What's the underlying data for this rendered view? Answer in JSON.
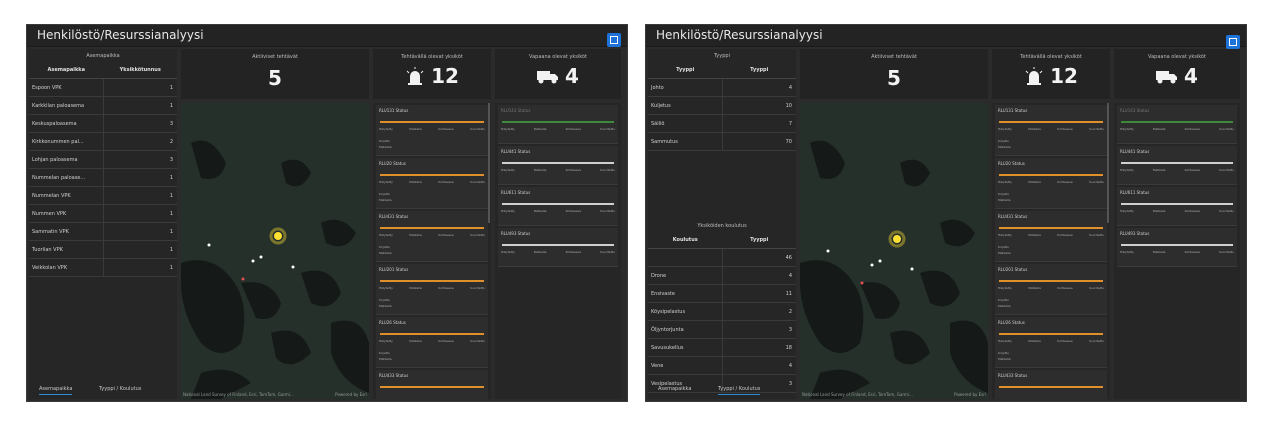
{
  "app_title": "Henkilöstö/Resurssianalyysi",
  "colors": {
    "accent": "#1e73d9",
    "orange": "#e0902a",
    "bg": "#2b2b2b",
    "marker": "#ffe033"
  },
  "icons": {
    "expand": "expand-icon",
    "siren": "siren-icon",
    "truck": "truck-icon"
  },
  "kpis": {
    "active_title": "Aktiiviset tehtävät",
    "active_value": "5",
    "onmission_title": "Tehtävällä olevat yksiköt",
    "onmission_value": "12",
    "free_title": "Vapaana olevat yksiköt",
    "free_value": "4"
  },
  "left": {
    "panel_title": "Asemapaikka",
    "headers": [
      "Asemapaikka",
      "Yksikkötunnus"
    ],
    "rows": [
      {
        "name": "Espoon VPK",
        "value": "1"
      },
      {
        "name": "Karkkilan paloasema",
        "value": "1"
      },
      {
        "name": "Keskuspaloasema",
        "value": "3"
      },
      {
        "name": "Kirkkonummen pal...",
        "value": "2"
      },
      {
        "name": "Lohjan paloasema",
        "value": "3"
      },
      {
        "name": "Nummelan paloase...",
        "value": "1"
      },
      {
        "name": "Nummelan VPK",
        "value": "1"
      },
      {
        "name": "Nummen VPK",
        "value": "1"
      },
      {
        "name": "Sammatin VPK",
        "value": "1"
      },
      {
        "name": "Tuorilan VPK",
        "value": "1"
      },
      {
        "name": "Veikkolan VPK",
        "value": "1"
      }
    ],
    "tabs": [
      "Asemapaikka",
      "Tyyppi / Koulutus"
    ]
  },
  "right": {
    "type_title": "Tyyppi",
    "type_headers": [
      "Tyyppi",
      "Tyyppi"
    ],
    "type_rows": [
      {
        "name": "Johto",
        "value": "4"
      },
      {
        "name": "Kuljetus",
        "value": "10"
      },
      {
        "name": "Säiliö",
        "value": "7"
      },
      {
        "name": "Sammutus",
        "value": "70"
      }
    ],
    "training_title": "Yksiköiden koulutus",
    "training_headers": [
      "Koulutus",
      "Tyyppi"
    ],
    "training_rows": [
      {
        "name": "",
        "value": "46"
      },
      {
        "name": "Drone",
        "value": "4"
      },
      {
        "name": "Ensivaste",
        "value": "11"
      },
      {
        "name": "Köysipelastus",
        "value": "2"
      },
      {
        "name": "Öljyntorjunta",
        "value": "3"
      },
      {
        "name": "Savusukellus",
        "value": "18"
      },
      {
        "name": "Vene",
        "value": "4"
      },
      {
        "name": "Vesipelastus",
        "value": "3"
      }
    ],
    "tabs": [
      "Asemapaikka",
      "Tyyppi / Koulutus"
    ]
  },
  "map": {
    "attribution": "National Land Survey of Finland, Esri, TomTom, Garmi...",
    "powered": "Powered by Esri"
  },
  "status_cards": [
    {
      "title": "RLU131 Status"
    },
    {
      "title": "RLU20 Status"
    },
    {
      "title": "RLU431 Status"
    },
    {
      "title": "RLU201 Status"
    },
    {
      "title": "RLU26 Status"
    },
    {
      "title": "RLU433 Status"
    }
  ],
  "free_cards": [
    {
      "title": "RLU143 Status"
    },
    {
      "title": "RLU441 Status"
    },
    {
      "title": "RLU611 Status"
    },
    {
      "title": "RLU493 Status"
    }
  ],
  "status_labels": [
    "Hälytetty",
    "Matkalla",
    "Kohteessa",
    "Suoritettu"
  ],
  "card_lines": [
    "Kirjattu",
    "Matkalla"
  ]
}
